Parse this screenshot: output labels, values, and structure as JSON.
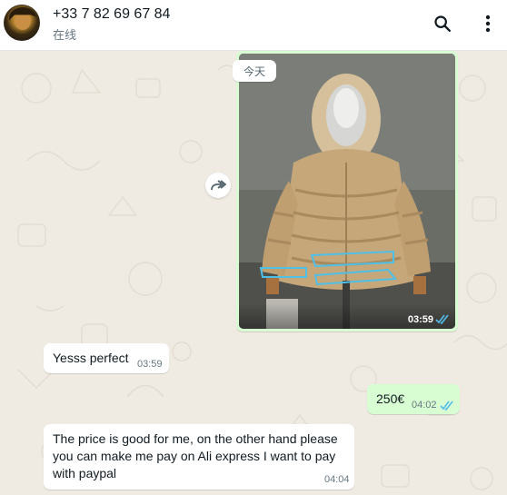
{
  "header": {
    "contact_name": "+33 7 82 69 67 84",
    "status": "在线"
  },
  "chat": {
    "date_divider": "今天",
    "messages": [
      {
        "type": "image",
        "direction": "outgoing",
        "time": "03:59",
        "status": "read"
      },
      {
        "type": "text",
        "direction": "incoming",
        "text": "Yesss perfect",
        "time": "03:59"
      },
      {
        "type": "text",
        "direction": "outgoing",
        "text": "250€",
        "time": "04:02",
        "status": "read"
      },
      {
        "type": "text",
        "direction": "incoming",
        "text": "The price is good for me, on the other hand please you can make me pay on Ali express I want to pay with paypal",
        "time": "04:04"
      }
    ]
  },
  "icons": [
    "search-icon",
    "menu-dots-icon",
    "forward-icon",
    "double-check-icon"
  ],
  "colors": {
    "chat_bg": "#efeae2",
    "outgoing_bubble": "#d9fdd3",
    "incoming_bubble": "#ffffff",
    "read_ticks": "#53bdeb"
  }
}
